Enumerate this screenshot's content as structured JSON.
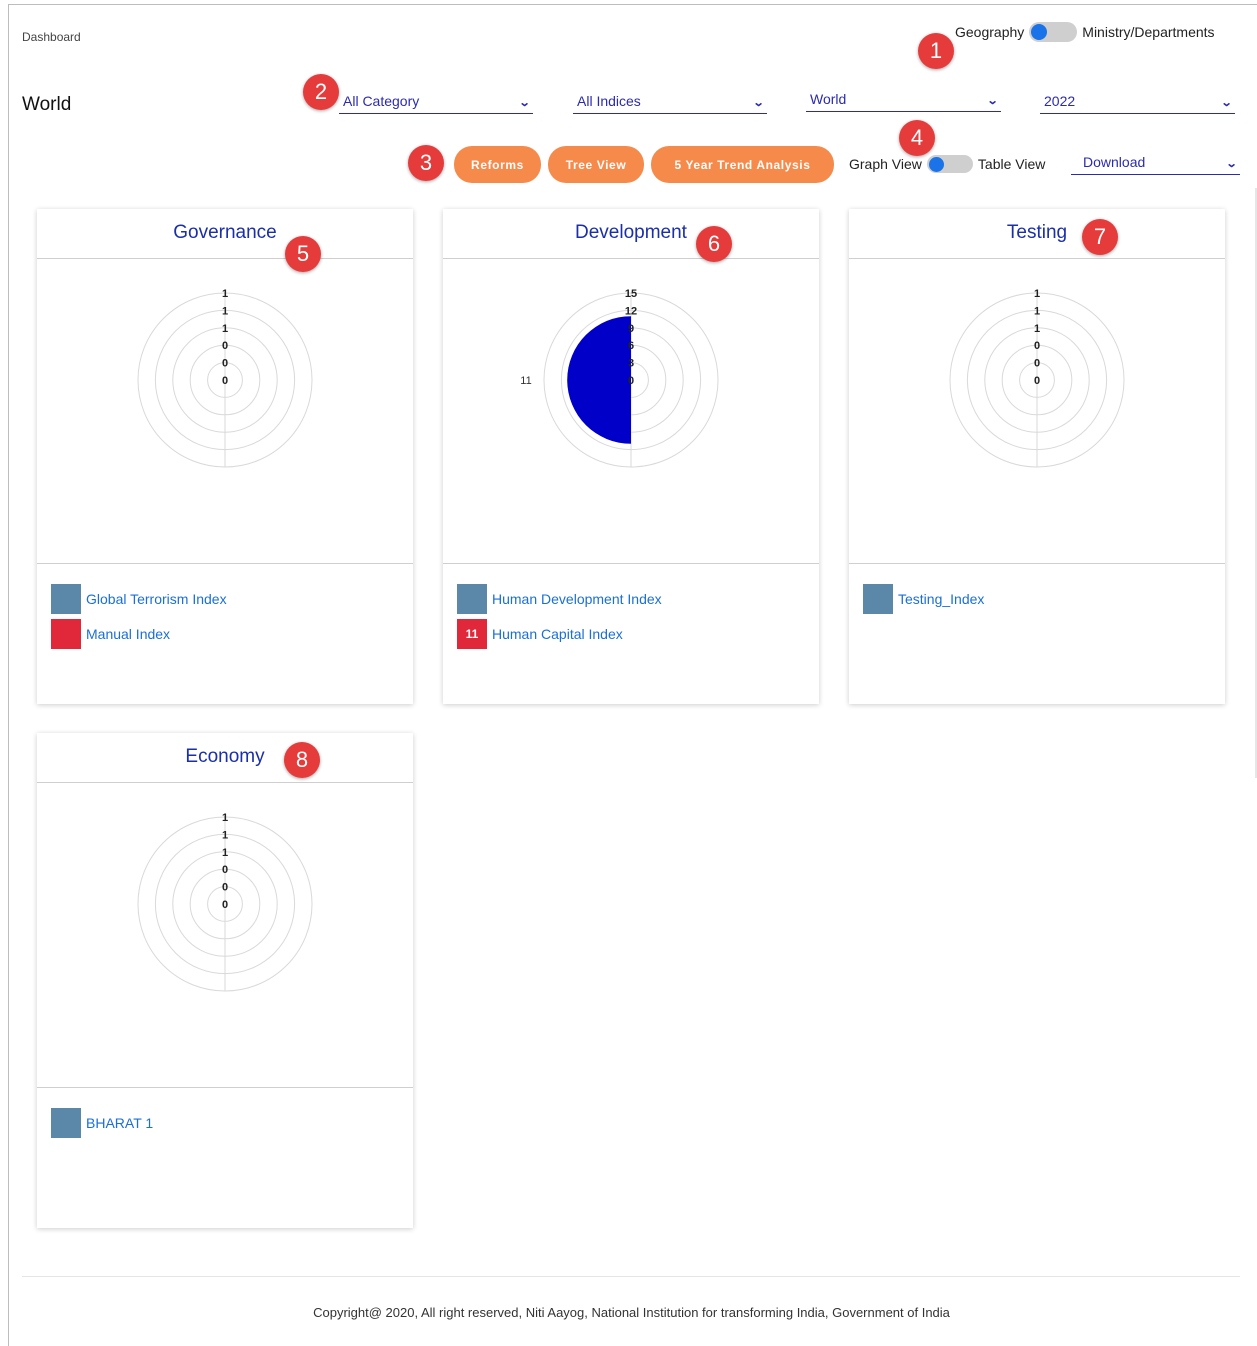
{
  "breadcrumb": "Dashboard",
  "geo_toggle": {
    "left_label": "Geography",
    "right_label": "Ministry/Departments"
  },
  "page_title": "World",
  "filters": {
    "category": "All Category",
    "indices": "All Indices",
    "region": "World",
    "year": "2022"
  },
  "actions": {
    "reforms": "Reforms",
    "tree_view": "Tree View",
    "trend": "5 Year Trend Analysis"
  },
  "view_toggle": {
    "left_label": "Graph View",
    "right_label": "Table View"
  },
  "download": "Download",
  "badges": [
    "1",
    "2",
    "3",
    "4",
    "5",
    "6",
    "7",
    "8"
  ],
  "colors": {
    "accent": "#2b2bb0",
    "button": "#f58a4b",
    "badge": "#e63b3b",
    "series_blue": "#0000c8",
    "swatch_blue": "#5b88a8",
    "swatch_red": "#e0283a"
  },
  "cards": [
    {
      "title": "Governance",
      "legend": [
        {
          "label": "Global Terrorism Index",
          "color": "#5b88a8",
          "value": ""
        },
        {
          "label": "Manual Index",
          "color": "#e0283a",
          "value": ""
        }
      ]
    },
    {
      "title": "Development",
      "legend": [
        {
          "label": "Human Development Index",
          "color": "#5b88a8",
          "value": ""
        },
        {
          "label": "Human Capital Index",
          "color": "#e0283a",
          "value": "11"
        }
      ]
    },
    {
      "title": "Testing",
      "legend": [
        {
          "label": "Testing_Index",
          "color": "#5b88a8",
          "value": ""
        }
      ]
    },
    {
      "title": "Economy",
      "legend": [
        {
          "label": "BHARAT 1",
          "color": "#5b88a8",
          "value": ""
        }
      ]
    }
  ],
  "chart_data": [
    {
      "type": "polar",
      "title": "Governance",
      "radial_ticks": [
        "0",
        "0",
        "0",
        "1",
        "1",
        "1"
      ],
      "series": []
    },
    {
      "type": "polar",
      "title": "Development",
      "radial_ticks": [
        "0",
        "3",
        "6",
        "9",
        "12",
        "15"
      ],
      "rmax": 15,
      "series": [
        {
          "name": "Human Capital Index",
          "value": 11,
          "color": "#0000c8",
          "angle_start_deg": 180,
          "angle_end_deg": 360,
          "label": "11"
        }
      ]
    },
    {
      "type": "polar",
      "title": "Testing",
      "radial_ticks": [
        "0",
        "0",
        "0",
        "1",
        "1",
        "1"
      ],
      "series": []
    },
    {
      "type": "polar",
      "title": "Economy",
      "radial_ticks": [
        "0",
        "0",
        "0",
        "1",
        "1",
        "1"
      ],
      "series": []
    }
  ],
  "footer": "Copyright@ 2020, All right reserved, Niti Aayog, National Institution for transforming India, Government of India"
}
